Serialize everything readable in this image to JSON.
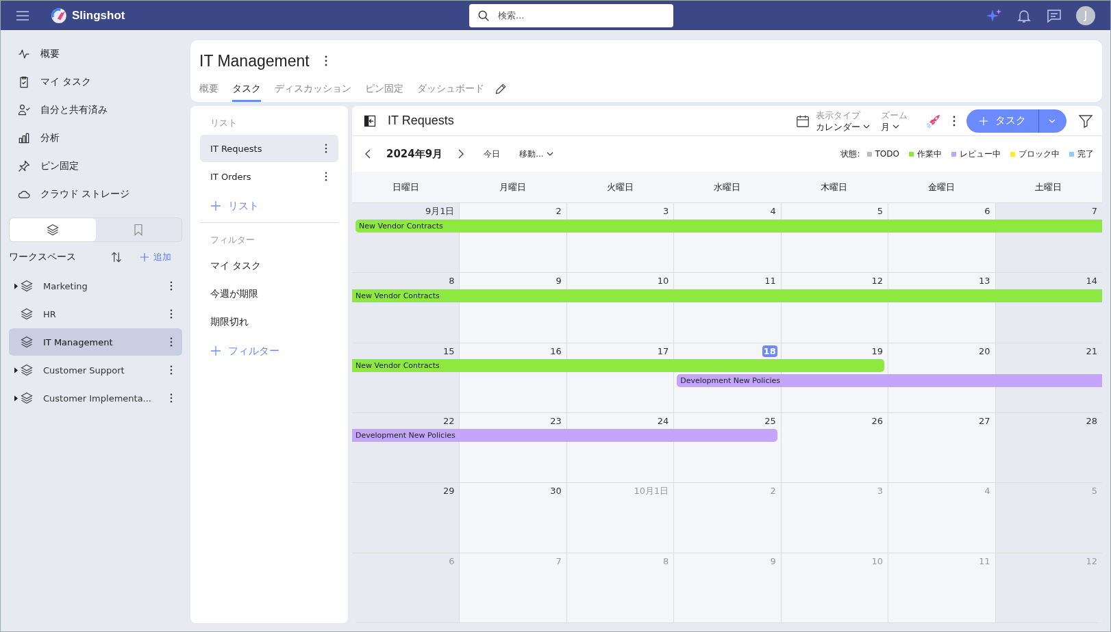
{
  "topbar": {
    "app_name": "Slingshot",
    "search": {
      "placeholder": "検索..."
    },
    "avatar": "J"
  },
  "nav": [
    {
      "label": "概要"
    },
    {
      "label": "マイ タスク"
    },
    {
      "label": "自分と共有済み"
    },
    {
      "label": "分析"
    },
    {
      "label": "ピン固定"
    },
    {
      "label": "クラウド ストレージ"
    }
  ],
  "sidebar_tabs": [
    {
      "selected": true
    },
    {
      "selected": false
    }
  ],
  "workspaces": {
    "title": "ワークスペース",
    "add": "追加",
    "items": [
      {
        "label": "Marketing",
        "expandable": true,
        "selected": false
      },
      {
        "label": "HR",
        "expandable": false,
        "selected": false
      },
      {
        "label": "IT Management",
        "expandable": false,
        "selected": true
      },
      {
        "label": "Customer Support",
        "expandable": true,
        "selected": false
      },
      {
        "label": "Customer Implementa...",
        "expandable": true,
        "selected": false
      }
    ]
  },
  "project": {
    "title": "IT Management",
    "tabs": [
      {
        "label": "概要",
        "selected": false
      },
      {
        "label": "タスク",
        "selected": true
      },
      {
        "label": "ディスカッション",
        "selected": false
      },
      {
        "label": "ピン固定",
        "selected": false
      },
      {
        "label": "ダッシュボード",
        "selected": false
      }
    ]
  },
  "lists": {
    "heading": "リスト",
    "items": [
      {
        "label": "IT Requests",
        "selected": true
      },
      {
        "label": "IT Orders",
        "selected": false
      }
    ],
    "add": "リスト"
  },
  "filters": {
    "heading": "フィルター",
    "items": [
      "マイ タスク",
      "今週が期限",
      "期限切れ"
    ],
    "add": "フィルター"
  },
  "calendar": {
    "title": "IT Requests",
    "view_type": {
      "label": "表示タイプ",
      "value": "カレンダー"
    },
    "zoom": {
      "label": "ズーム",
      "value": "月"
    },
    "add_button": "タスク",
    "month": "2024年9月",
    "today": "今日",
    "goto": "移動...",
    "status_label": "状態:",
    "statuses": [
      {
        "label": "TODO",
        "color": "#bdbdbd"
      },
      {
        "label": "作業中",
        "color": "#8de83f"
      },
      {
        "label": "レビュー中",
        "color": "#c3a6fb"
      },
      {
        "label": "ブロック中",
        "color": "#ffe83d"
      },
      {
        "label": "完了",
        "color": "#90cafa"
      }
    ],
    "weekdays": [
      "日曜日",
      "月曜日",
      "火曜日",
      "水曜日",
      "木曜日",
      "金曜日",
      "土曜日"
    ],
    "weeks": [
      {
        "days": [
          {
            "label": "9月1日",
            "other_month": false,
            "today": false
          },
          {
            "label": "2",
            "other_month": false,
            "today": false
          },
          {
            "label": "3",
            "other_month": false,
            "today": false
          },
          {
            "label": "4",
            "other_month": false,
            "today": false
          },
          {
            "label": "5",
            "other_month": false,
            "today": false
          },
          {
            "label": "6",
            "other_month": false,
            "today": false
          },
          {
            "label": "7",
            "other_month": false,
            "today": false
          }
        ],
        "events": [
          {
            "title": "New Vendor Contracts",
            "color": "#8de83f",
            "starts": true,
            "ends": false
          }
        ]
      },
      {
        "days": [
          {
            "label": "8",
            "other_month": false,
            "today": false
          },
          {
            "label": "9",
            "other_month": false,
            "today": false
          },
          {
            "label": "10",
            "other_month": false,
            "today": false
          },
          {
            "label": "11",
            "other_month": false,
            "today": false
          },
          {
            "label": "12",
            "other_month": false,
            "today": false
          },
          {
            "label": "13",
            "other_month": false,
            "today": false
          },
          {
            "label": "14",
            "other_month": false,
            "today": false
          }
        ],
        "events": [
          {
            "title": "New Vendor Contracts",
            "color": "#8de83f",
            "starts": false,
            "ends": false
          }
        ]
      },
      {
        "days": [
          {
            "label": "15",
            "other_month": false,
            "today": false
          },
          {
            "label": "16",
            "other_month": false,
            "today": false
          },
          {
            "label": "17",
            "other_month": false,
            "today": false
          },
          {
            "label": "18",
            "other_month": false,
            "today": true
          },
          {
            "label": "19",
            "other_month": false,
            "today": false
          },
          {
            "label": "20",
            "other_month": false,
            "today": false
          },
          {
            "label": "21",
            "other_month": false,
            "today": false
          }
        ],
        "events": [
          {
            "title": "New Vendor Contracts",
            "color": "#8de83f",
            "starts": false,
            "ends": true
          },
          {
            "title": "Development New Policies",
            "color": "#c3a6fb",
            "starts": true,
            "ends": false
          }
        ]
      },
      {
        "days": [
          {
            "label": "22",
            "other_month": false,
            "today": false
          },
          {
            "label": "23",
            "other_month": false,
            "today": false
          },
          {
            "label": "24",
            "other_month": false,
            "today": false
          },
          {
            "label": "25",
            "other_month": false,
            "today": false
          },
          {
            "label": "26",
            "other_month": false,
            "today": false
          },
          {
            "label": "27",
            "other_month": false,
            "today": false
          },
          {
            "label": "28",
            "other_month": false,
            "today": false
          }
        ],
        "events": [
          {
            "title": "Development New Policies",
            "color": "#c3a6fb",
            "starts": false,
            "ends": true
          }
        ]
      },
      {
        "days": [
          {
            "label": "29",
            "other_month": false,
            "today": false
          },
          {
            "label": "30",
            "other_month": false,
            "today": false
          },
          {
            "label": "10月1日",
            "other_month": true,
            "today": false
          },
          {
            "label": "2",
            "other_month": true,
            "today": false
          },
          {
            "label": "3",
            "other_month": true,
            "today": false
          },
          {
            "label": "4",
            "other_month": true,
            "today": false
          },
          {
            "label": "5",
            "other_month": true,
            "today": false
          }
        ]
      },
      {
        "days": [
          {
            "label": "6",
            "other_month": true,
            "today": false
          },
          {
            "label": "7",
            "other_month": true,
            "today": false
          },
          {
            "label": "8",
            "other_month": true,
            "today": false
          },
          {
            "label": "9",
            "other_month": true,
            "today": false
          },
          {
            "label": "10",
            "other_month": true,
            "today": false
          },
          {
            "label": "11",
            "other_month": true,
            "today": false
          },
          {
            "label": "12",
            "other_month": true,
            "today": false
          }
        ]
      }
    ]
  }
}
